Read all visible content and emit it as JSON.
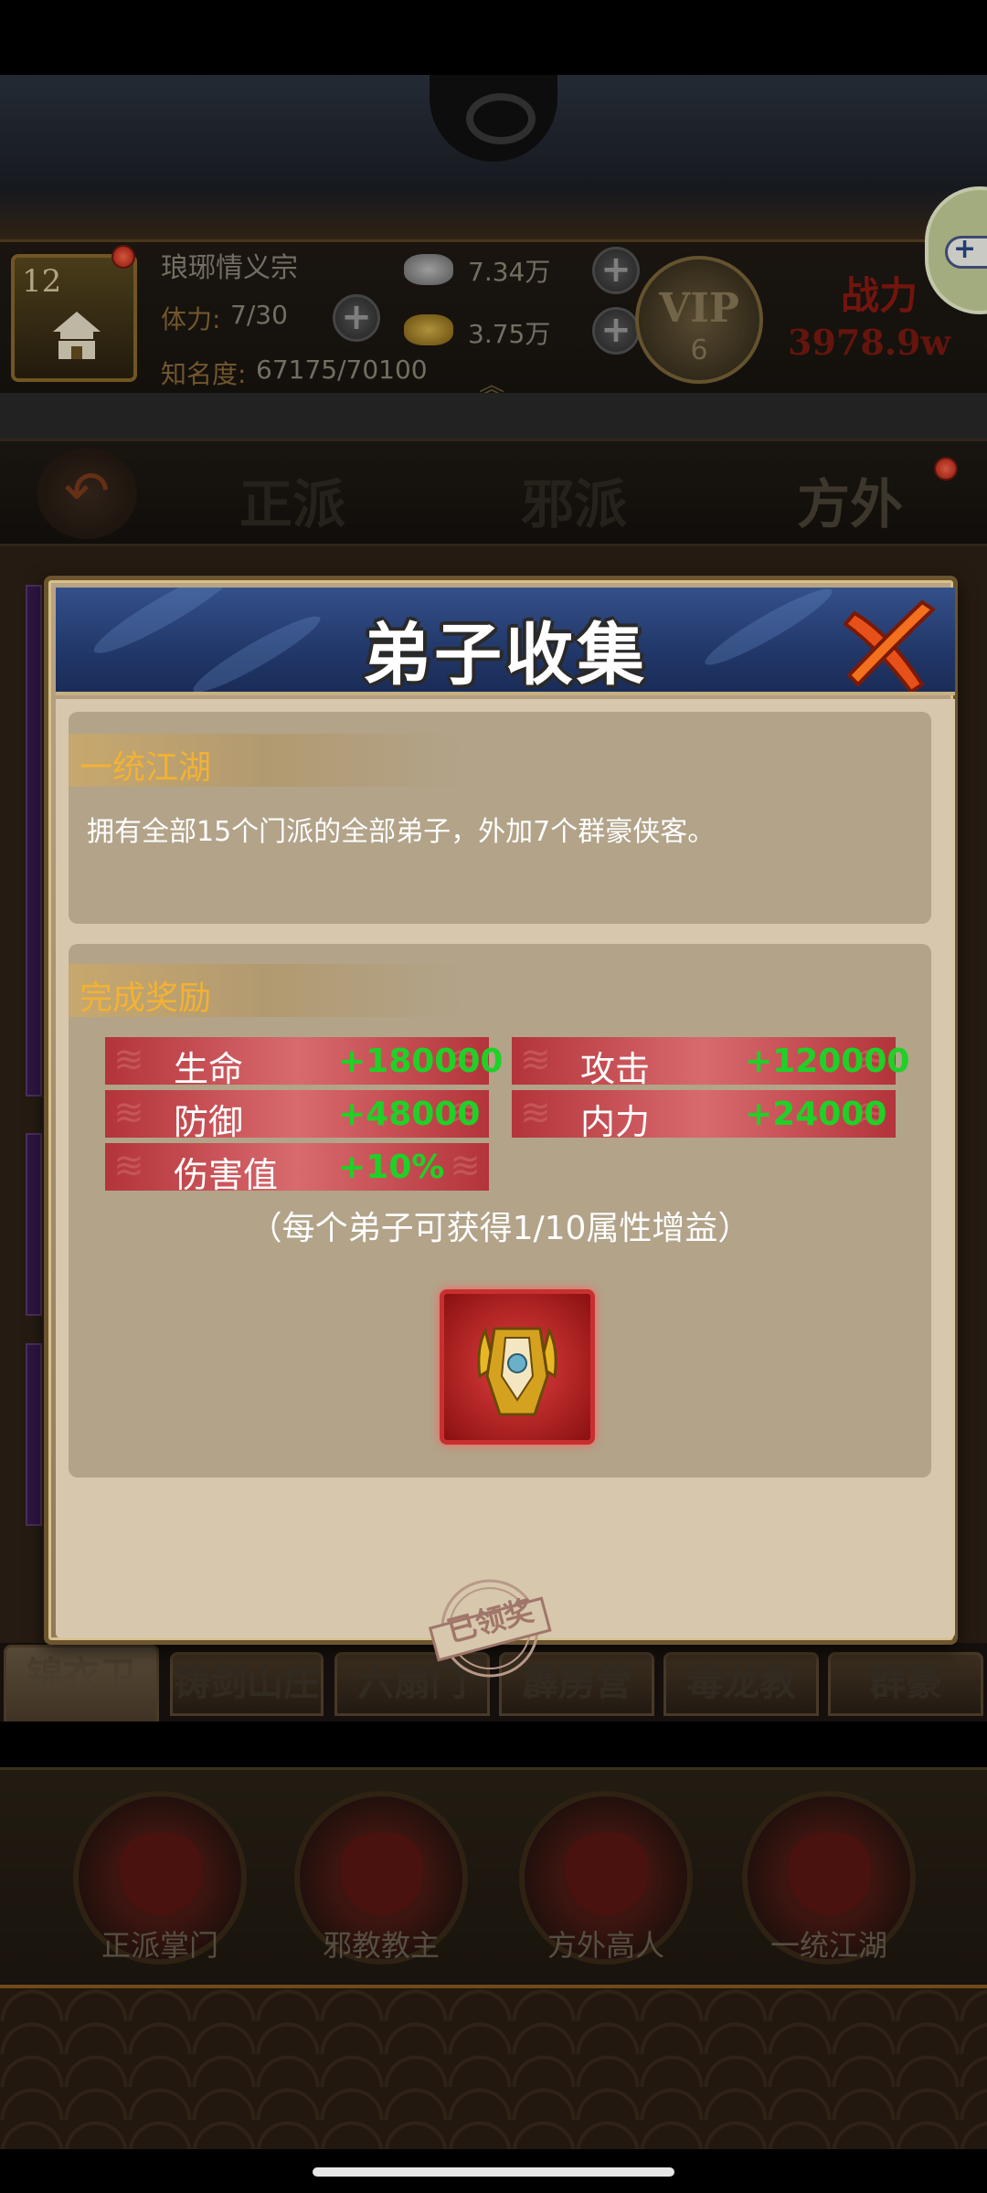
{
  "player": {
    "level": "12",
    "name": "琅琊情义宗",
    "stamina_label": "体力:",
    "stamina_value": "7/30",
    "fame_label": "知名度:",
    "fame_value": "67175/70100",
    "silver": "7.34万",
    "gold": "3.75万",
    "vip_text": "VIP",
    "vip_level": "6",
    "power_label": "战力",
    "power_value": "3978.9w"
  },
  "faction_tabs": [
    "正派",
    "邪派",
    "方外"
  ],
  "bottom_tabs": [
    "锦衣卫",
    "铸剑山庄",
    "六扇门",
    "霹雳营",
    "毒龙教",
    "群豪"
  ],
  "leaders": [
    "正派掌门",
    "邪教教主",
    "方外高人",
    "一统江湖"
  ],
  "modal": {
    "title": "弟子收集",
    "section1_title": "一统江湖",
    "description": "拥有全部15个门派的全部弟子，外加7个群豪侠客。",
    "section2_title": "完成奖励",
    "attributes": [
      {
        "name": "生命",
        "value": "+180000"
      },
      {
        "name": "攻击",
        "value": "+120000"
      },
      {
        "name": "防御",
        "value": "+48000"
      },
      {
        "name": "内力",
        "value": "+24000"
      },
      {
        "name": "伤害值",
        "value": "+10%"
      }
    ],
    "note": "（每个弟子可获得1/10属性增益）",
    "claimed_stamp": "已领奖"
  },
  "colors": {
    "title_blue": "#22386a",
    "heading_orange": "#f2b233",
    "bonus_green": "#1fd127",
    "attr_red": "#b3343a"
  }
}
